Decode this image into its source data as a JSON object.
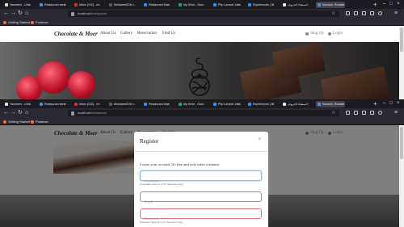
{
  "browser": {
    "tabs": [
      {
        "title": "Yasmeen - Untu",
        "fav": "#e0e0e0"
      },
      {
        "title": "Restaurant send",
        "fav": "#4a90d9"
      },
      {
        "title": "Inbox (212) - m",
        "fav": "#d93025"
      },
      {
        "title": "Mohamed21N -",
        "fav": "#5a5a5a"
      },
      {
        "title": "Restaurant Man",
        "fav": "#2d8cff"
      },
      {
        "title": "My Drive - Goo",
        "fav": "#1fa463"
      },
      {
        "title": "Php Laravel Jobs",
        "fav": "#2d8cff"
      },
      {
        "title": "Experiences | W",
        "fav": "#2d8cff"
      },
      {
        "title": "استفتاء الحروف",
        "fav": "#e6e6e6"
      },
      {
        "title": "Mondok: Restaur",
        "fav": "#4a90d9"
      }
    ],
    "active_tab_index": 9,
    "url_host": "localhost",
    "url_path": "/restaurant/",
    "bookmarks": [
      {
        "label": "Getting Started",
        "color": "#ff7139"
      },
      {
        "label": "Postman",
        "color": "#ff6c37"
      }
    ]
  },
  "site": {
    "brand": "Chocolate & Moer",
    "menu": [
      "About Us",
      "Gallery",
      "Reservation",
      "Find Us"
    ],
    "sign_up": "Sing Up",
    "login": "Login"
  },
  "modal": {
    "title": "Register",
    "close": "×",
    "description": "Create your account. It's free and only takes a minute.",
    "username_placeholder": "Username",
    "username_hint": "Username must be 4-25 characters long",
    "email_placeholder": "Email",
    "password_placeholder": "Password",
    "password_hint": "Password must be 6-20 characters long"
  }
}
